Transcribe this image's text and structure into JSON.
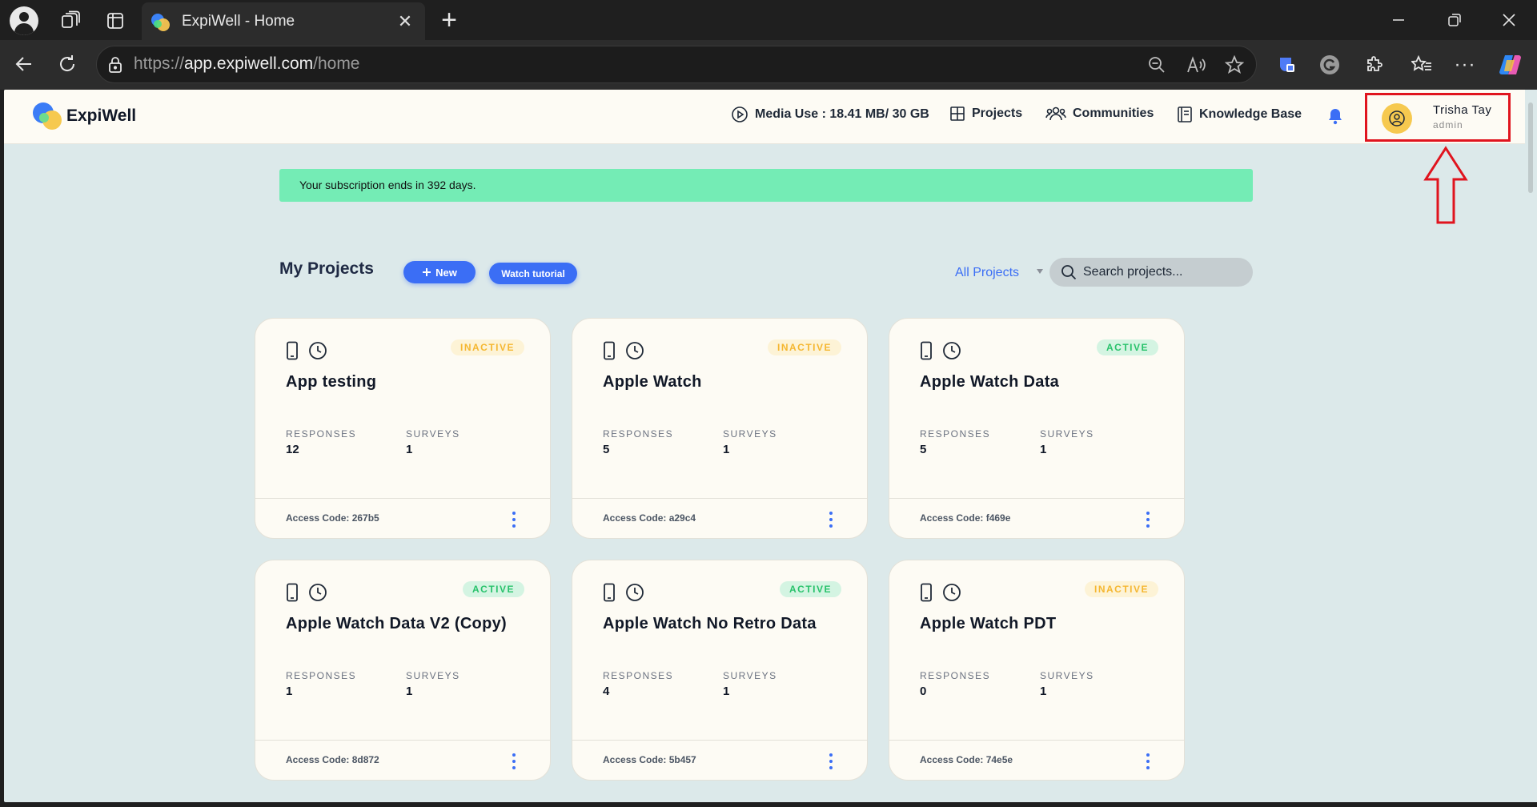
{
  "browser": {
    "tab_title": "ExpiWell - Home",
    "url_scheme": "https://",
    "url_host": "app.expiwell.com",
    "url_path": "/home"
  },
  "header": {
    "brand": "ExpiWell",
    "media_use": "Media Use : 18.41 MB/ 30 GB",
    "nav": {
      "projects": "Projects",
      "communities": "Communities",
      "knowledge_base": "Knowledge Base"
    },
    "user": {
      "name": "Trisha Tay",
      "role": "admin"
    }
  },
  "banner": "Your subscription ends in 392 days.",
  "projects_section": {
    "title": "My Projects",
    "new_label": "New",
    "tutorial_label": "Watch tutorial",
    "filter_label": "All Projects",
    "search_placeholder": "Search projects..."
  },
  "labels": {
    "responses": "RESPONSES",
    "surveys": "SURVEYS"
  },
  "projects": [
    {
      "name": "App testing",
      "status": "INACTIVE",
      "responses": "12",
      "surveys": "1",
      "access_code": "Access Code: 267b5"
    },
    {
      "name": "Apple Watch",
      "status": "INACTIVE",
      "responses": "5",
      "surveys": "1",
      "access_code": "Access Code: a29c4"
    },
    {
      "name": "Apple Watch Data",
      "status": "ACTIVE",
      "responses": "5",
      "surveys": "1",
      "access_code": "Access Code: f469e"
    },
    {
      "name": "Apple Watch Data V2 (Copy)",
      "status": "ACTIVE",
      "responses": "1",
      "surveys": "1",
      "access_code": "Access Code: 8d872"
    },
    {
      "name": "Apple Watch No Retro Data",
      "status": "ACTIVE",
      "responses": "4",
      "surveys": "1",
      "access_code": "Access Code: 5b457"
    },
    {
      "name": "Apple Watch PDT",
      "status": "INACTIVE",
      "responses": "0",
      "surveys": "1",
      "access_code": "Access Code: 74e5e"
    }
  ],
  "colors": {
    "accent": "#3b6ef5",
    "banner": "#74ecb5",
    "active": "#28c26b",
    "inactive": "#f5b731",
    "highlight": "#e0141e"
  }
}
